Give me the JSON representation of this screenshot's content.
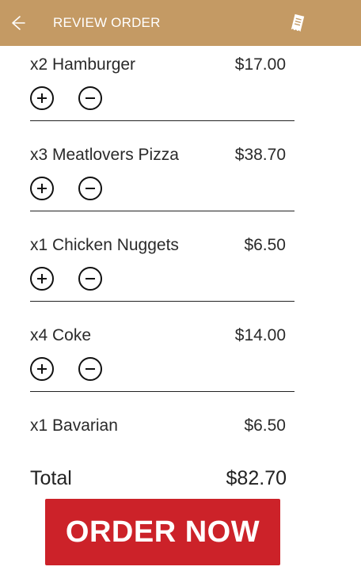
{
  "header": {
    "title": "REVIEW ORDER",
    "back_icon": "arrow-left-icon",
    "receipt_icon": "receipt-icon",
    "background": "#c49a64"
  },
  "items": [
    {
      "name": "x2 Hamburger",
      "price": "$17.00"
    },
    {
      "name": "x3 Meatlovers Pizza",
      "price": "$38.70"
    },
    {
      "name": "x1 Chicken Nuggets",
      "price": "$6.50"
    },
    {
      "name": "x4 Coke",
      "price": "$14.00"
    },
    {
      "name": "x1 Bavarian",
      "price": "$6.50"
    }
  ],
  "total": {
    "label": "Total",
    "value": "$82.70"
  },
  "order_button": {
    "label": "ORDER NOW",
    "color": "#cc2229"
  }
}
